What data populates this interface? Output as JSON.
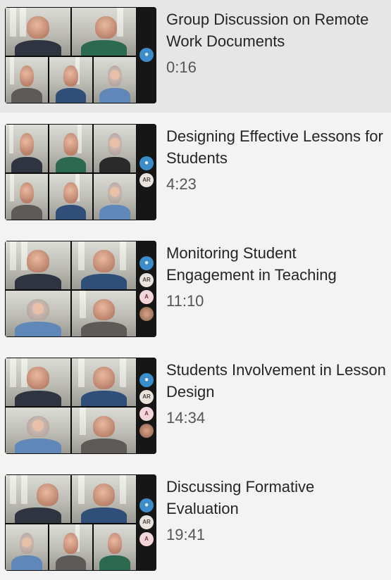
{
  "videos": [
    {
      "title": "Group Discussion on Remote Work Documents",
      "time": "0:16",
      "selected": true,
      "avatars": [
        "user"
      ]
    },
    {
      "title": "Designing Effective Lessons for Students",
      "time": "4:23",
      "selected": false,
      "avatars": [
        "user",
        "AR"
      ]
    },
    {
      "title": "Monitoring Student Engagement in Teaching",
      "time": "11:10",
      "selected": false,
      "avatars": [
        "user",
        "AR",
        "A",
        "photo"
      ]
    },
    {
      "title": "Students Involvement in Lesson Design",
      "time": "14:34",
      "selected": false,
      "avatars": [
        "user",
        "AR",
        "A",
        "photo"
      ]
    },
    {
      "title": "Discussing Formative Evaluation",
      "time": "19:41",
      "selected": false,
      "avatars": [
        "user",
        "AR",
        "A"
      ]
    }
  ],
  "icons": {
    "user": "person-icon",
    "photo": "participant-photo"
  },
  "colors": {
    "selected_bg": "#e6e6e6",
    "list_bg": "#f3f3f3",
    "avatar_blue": "#3b8ec9"
  }
}
